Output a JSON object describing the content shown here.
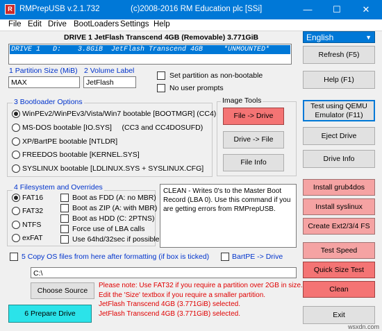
{
  "window": {
    "title_app": "RMPrepUSB v.2.1.732",
    "title_copyright": "(c)2008-2016 RM Education plc [SSi]",
    "controls": {
      "minimize": "—",
      "maximize": "☐",
      "close": "✕"
    }
  },
  "menu": [
    "File",
    "Edit",
    "Drive",
    "BootLoaders",
    "Settings",
    "Help"
  ],
  "drive_header": "DRIVE 1  JetFlash Transcend 4GB  (Removable) 3.771GiB",
  "drive_list_row": "DRIVE 1   D:    3.8GiB  JetFlash Transcend 4GB     *UNMOUNTED*",
  "language": {
    "selected": "English"
  },
  "partition": {
    "size_label": "1 Partition Size (MiB)",
    "size_value": "MAX",
    "volume_label": "2 Volume Label",
    "volume_value": "JetFlash"
  },
  "options": {
    "non_bootable": "Set partition as non-bootable",
    "no_prompts": "No user prompts"
  },
  "bootloader": {
    "title": "3 Bootloader Options",
    "items": [
      "WinPEv2/WinPEv3/Vista/Win7 bootable [BOOTMGR] (CC4)",
      "MS-DOS bootable [IO.SYS]     (CC3 and CC4DOSUFD)",
      "XP/BartPE bootable [NTLDR]",
      "FREEDOS bootable [KERNEL.SYS]",
      "SYSLINUX bootable [LDLINUX.SYS + SYSLINUX.CFG]"
    ]
  },
  "image_tools": {
    "title": "Image Tools",
    "file_to_drive": "File -> Drive",
    "drive_to_file": "Drive -> File",
    "file_info": "File Info"
  },
  "filesystem": {
    "title": "4 Filesystem and Overrides",
    "types": [
      "FAT16",
      "FAT32",
      "NTFS",
      "exFAT"
    ],
    "overrides": [
      "Boot as FDD (A: no MBR)",
      "Boot as ZIP (A: with MBR)",
      "Boot as HDD (C: 2PTNS)",
      "Force use of LBA calls",
      "Use 64hd/32sec if possible"
    ]
  },
  "clean_info": "CLEAN - Writes 0's to the Master Boot Record (LBA 0). Use this command if you are getting errors from RMPrepUSB.",
  "copy_os": {
    "label": "5 Copy OS files from here after formatting (if box is ticked)",
    "bartpe": "BartPE -> Drive",
    "path": "C:\\",
    "choose_source": "Choose Source"
  },
  "messages": [
    "Please note: Use FAT32 if you require a partition over 2GB in size.",
    "Edit the 'Size' textbox if you require a smaller partition.",
    "JetFlash Transcend 4GB (3.771GiB) selected.",
    "JetFlash Transcend 4GB (3.771GiB) selected."
  ],
  "prepare_drive": "6 Prepare Drive",
  "right_buttons": {
    "refresh": "Refresh (F5)",
    "help": "Help (F1)",
    "test_qemu": "Test using QEMU Emulator (F11)",
    "eject": "Eject Drive",
    "drive_info": "Drive Info",
    "install_grub4dos": "Install grub4dos",
    "install_syslinux": "Install syslinux",
    "create_ext": "Create Ext2/3/4 FS",
    "test_speed": "Test Speed",
    "quick_size_test": "Quick Size Test",
    "clean": "Clean",
    "exit": "Exit"
  },
  "watermark": "wsxdn.com"
}
